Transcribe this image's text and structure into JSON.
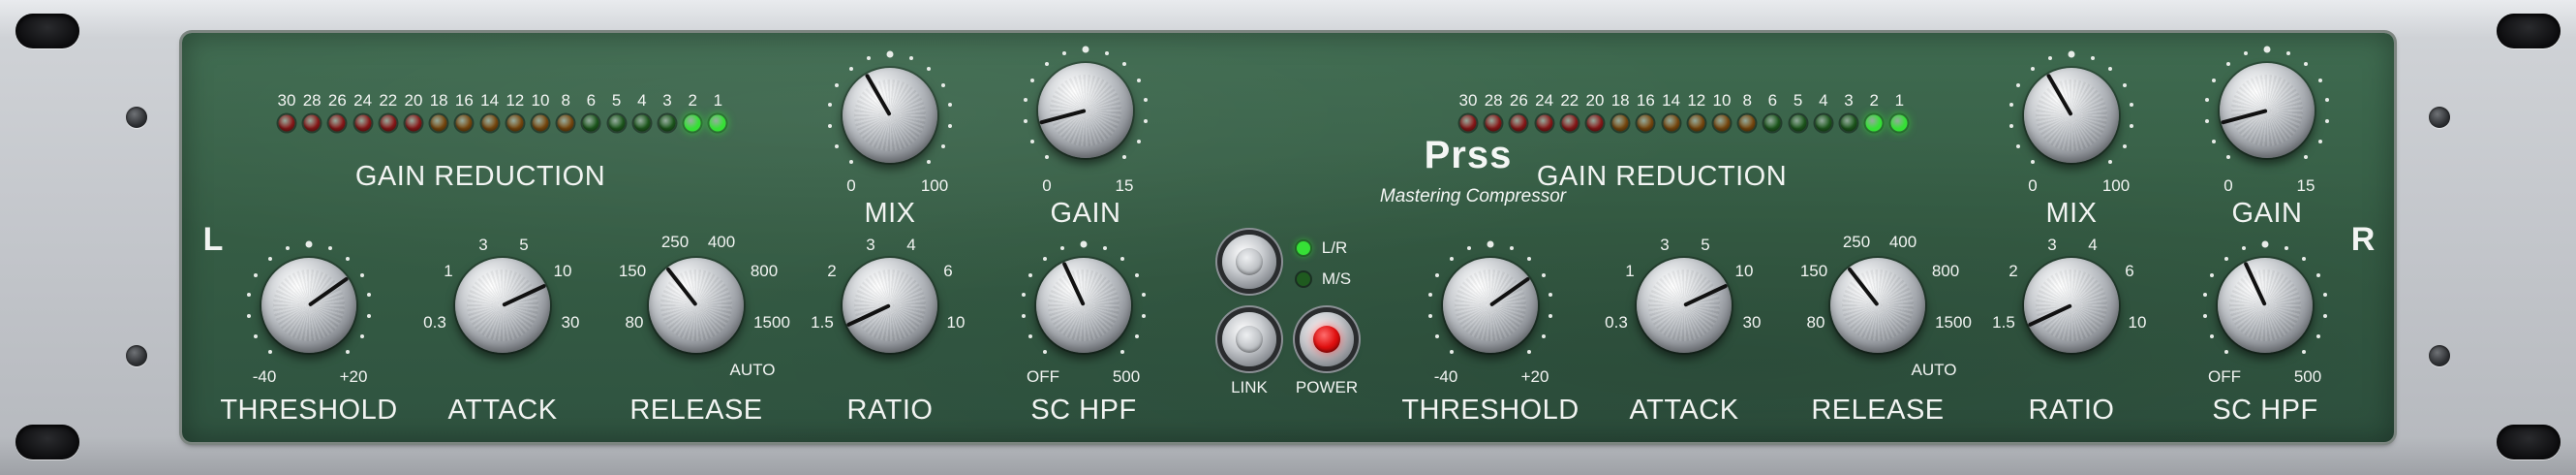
{
  "brand": {
    "name": "Prss",
    "subtitle": "Mastering Compressor"
  },
  "channels": [
    {
      "label": "L",
      "meter": {
        "label": "GAIN REDUCTION",
        "scale": [
          "30",
          "28",
          "26",
          "24",
          "22",
          "20",
          "18",
          "16",
          "14",
          "12",
          "10",
          "8",
          "6",
          "5",
          "4",
          "3",
          "2",
          "1"
        ],
        "led_colors": [
          "#8b1a1a",
          "#8b1a1a",
          "#8b1a1a",
          "#8b1a1a",
          "#8b1a1a",
          "#8b1a1a",
          "#7a4a10",
          "#7a4a10",
          "#7a4a10",
          "#7a4a10",
          "#7a4a10",
          "#7a4a10",
          "#1f5a1f",
          "#1f5a1f",
          "#1f5a1f",
          "#1f5a1f",
          "#36e036",
          "#36e036"
        ]
      },
      "controls": {
        "mix": {
          "label": "MIX",
          "min": "0",
          "max": "100"
        },
        "gain": {
          "label": "GAIN",
          "min": "0",
          "max": "15"
        },
        "threshold": {
          "label": "THRESHOLD",
          "min": "-40",
          "max": "+20"
        },
        "attack": {
          "label": "ATTACK",
          "ticks": [
            "0.3",
            "1",
            "3",
            "5",
            "10",
            "30"
          ]
        },
        "release": {
          "label": "RELEASE",
          "ticks": [
            "80",
            "150",
            "250",
            "400",
            "800",
            "1500"
          ],
          "auto": "AUTO"
        },
        "ratio": {
          "label": "RATIO",
          "ticks": [
            "1.5",
            "2",
            "3",
            "4",
            "6",
            "10"
          ]
        },
        "schpf": {
          "label": "SC HPF",
          "min": "OFF",
          "max": "500"
        }
      }
    },
    {
      "label": "R",
      "meter": {
        "label": "GAIN REDUCTION",
        "scale": [
          "30",
          "28",
          "26",
          "24",
          "22",
          "20",
          "18",
          "16",
          "14",
          "12",
          "10",
          "8",
          "6",
          "5",
          "4",
          "3",
          "2",
          "1"
        ],
        "led_colors": [
          "#8b1a1a",
          "#8b1a1a",
          "#8b1a1a",
          "#8b1a1a",
          "#8b1a1a",
          "#8b1a1a",
          "#7a4a10",
          "#7a4a10",
          "#7a4a10",
          "#7a4a10",
          "#7a4a10",
          "#7a4a10",
          "#1f5a1f",
          "#1f5a1f",
          "#1f5a1f",
          "#1f5a1f",
          "#36e036",
          "#36e036"
        ]
      },
      "controls": {
        "mix": {
          "label": "MIX",
          "min": "0",
          "max": "100"
        },
        "gain": {
          "label": "GAIN",
          "min": "0",
          "max": "15"
        },
        "threshold": {
          "label": "THRESHOLD",
          "min": "-40",
          "max": "+20"
        },
        "attack": {
          "label": "ATTACK",
          "ticks": [
            "0.3",
            "1",
            "3",
            "5",
            "10",
            "30"
          ]
        },
        "release": {
          "label": "RELEASE",
          "ticks": [
            "80",
            "150",
            "250",
            "400",
            "800",
            "1500"
          ],
          "auto": "AUTO"
        },
        "ratio": {
          "label": "RATIO",
          "ticks": [
            "1.5",
            "2",
            "3",
            "4",
            "6",
            "10"
          ]
        },
        "schpf": {
          "label": "SC HPF",
          "min": "OFF",
          "max": "500"
        }
      }
    }
  ],
  "center": {
    "mode": {
      "options": [
        "L/R",
        "M/S"
      ],
      "selected": "L/R"
    },
    "link_label": "LINK",
    "power_label": "POWER",
    "power_on": true
  },
  "colors": {
    "panel": "#355c44",
    "led_on": "#36e036",
    "power": "#e01010"
  }
}
